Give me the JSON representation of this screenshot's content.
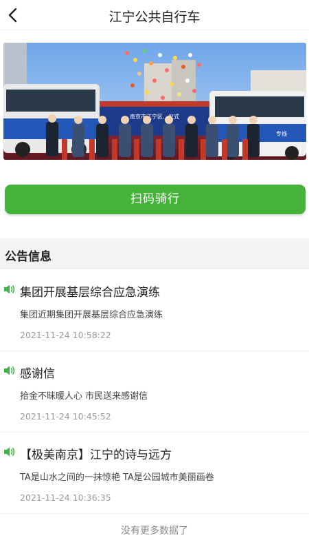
{
  "header": {
    "back_icon": "chevron-left-icon",
    "title": "江宁公共自行车"
  },
  "banner": {
    "banner_text": "南京市江宁区…仪式",
    "bus_side_text": "专线"
  },
  "ride_button": {
    "label": "扫码骑行"
  },
  "announcements": {
    "section_title": "公告信息",
    "items": [
      {
        "icon": "speaker-icon",
        "title": "集团开展基层综合应急演练",
        "summary": "集团近期集团开展基层综合应急演练",
        "time": "2021-11-24 10:58:22"
      },
      {
        "icon": "speaker-icon",
        "title": "感谢信",
        "summary": "拾金不昧暖人心 市民送来感谢信",
        "time": "2021-11-24 10:45:52"
      },
      {
        "icon": "speaker-icon",
        "title": "【极美南京】江宁的诗与远方",
        "summary": "TA是山水之间的一抹惊艳 TA是公园城市美丽画卷",
        "time": "2021-11-24 10:36:35"
      }
    ],
    "end_text": "没有更多数据了"
  },
  "colors": {
    "accent_green": "#45b339",
    "speaker_green": "#3fb24a",
    "section_bg": "#f3f3f3",
    "time_gray": "#9a9a9a"
  }
}
